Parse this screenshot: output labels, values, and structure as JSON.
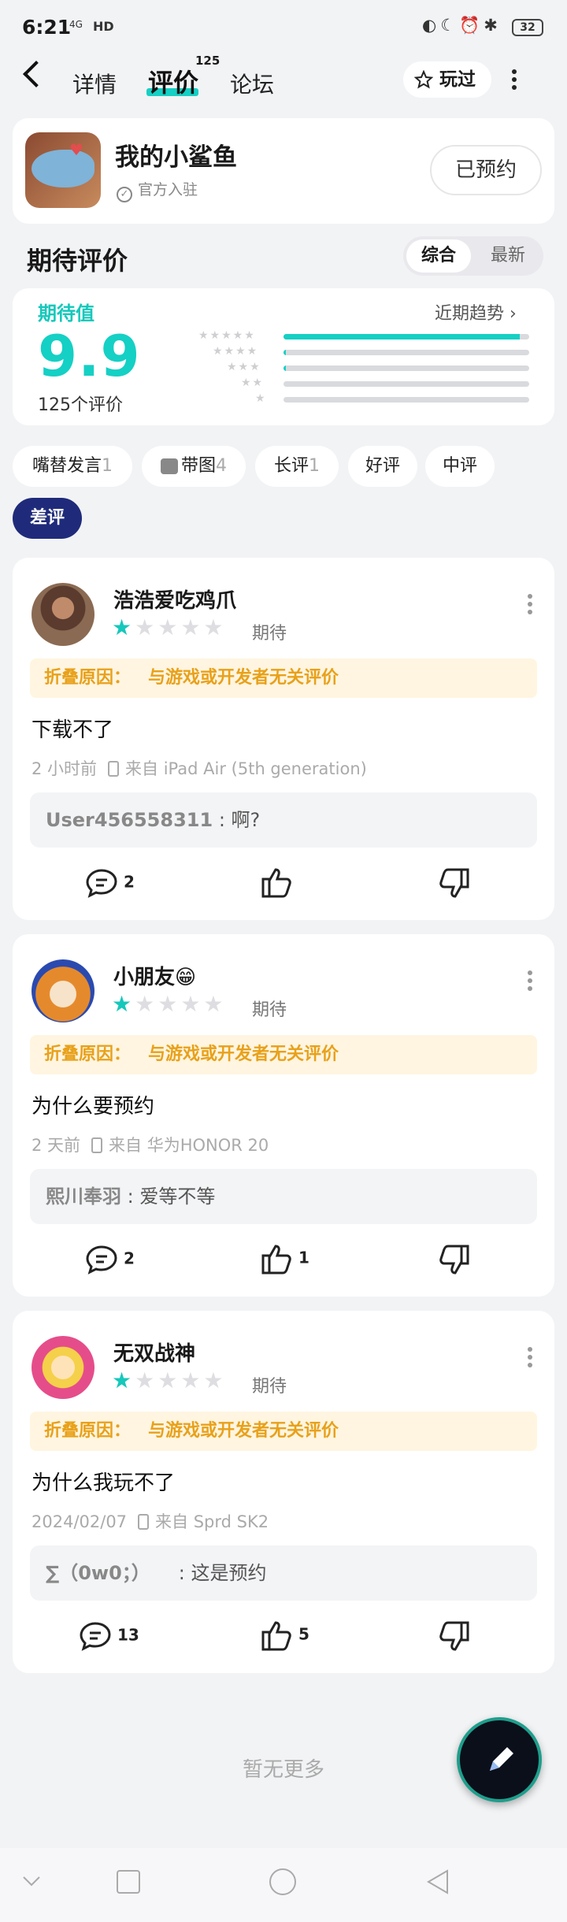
{
  "status": {
    "time": "6:21",
    "signal": "4G",
    "hd": "HD",
    "battery": "32"
  },
  "nav": {
    "tabs": [
      {
        "label": "详情"
      },
      {
        "label": "评价",
        "badge": "125"
      },
      {
        "label": "论坛"
      }
    ],
    "played_label": "玩过"
  },
  "game": {
    "name": "我的小鲨鱼",
    "official": "官方入驻",
    "reserve_label": "已预约"
  },
  "ratings": {
    "section_title": "期待评价",
    "sort_tabs": [
      "综合",
      "最新"
    ],
    "label": "期待值",
    "score": "9.9",
    "count": "125个评价",
    "trend_label": "近期趋势",
    "distribution": [
      0.96,
      0.01,
      0.01,
      0,
      0
    ]
  },
  "filters": [
    {
      "label": "嘴替发言",
      "count": "1"
    },
    {
      "label": "带图",
      "count": "4"
    },
    {
      "label": "长评",
      "count": "1"
    },
    {
      "label": "好评",
      "count": ""
    },
    {
      "label": "中评",
      "count": ""
    },
    {
      "label": "差评",
      "count": ""
    }
  ],
  "reviews": [
    {
      "user": "浩浩爱吃鸡爪",
      "stars": 1,
      "expect": "期待",
      "fold_label": "折叠原因：",
      "fold_reason": "与游戏或开发者无关评价",
      "content": "下载不了",
      "time": "2 小时前",
      "device": "来自 iPad Air (5th generation)",
      "reply_user": "User456558311",
      "reply_text": " : 啊?",
      "comments": "2",
      "likes": ""
    },
    {
      "user": "小朋友😁",
      "stars": 1,
      "expect": "期待",
      "fold_label": "折叠原因：",
      "fold_reason": "与游戏或开发者无关评价",
      "content": "为什么要预约",
      "time": "2 天前",
      "device": "来自 华为HONOR 20",
      "reply_user": "熙川奉羽",
      "reply_text": " : 爱等不等",
      "comments": "2",
      "likes": "1"
    },
    {
      "user": "无双战神",
      "stars": 1,
      "expect": "期待",
      "fold_label": "折叠原因：",
      "fold_reason": "与游戏或开发者无关评价",
      "content": "为什么我玩不了",
      "time": "2024/02/07",
      "device": "来自 Sprd SK2",
      "reply_user": "∑（0w0；）",
      "reply_text": "　　: 这是预约",
      "comments": "13",
      "likes": "5"
    }
  ],
  "footer": {
    "no_more": "暂无更多"
  },
  "colors": {
    "accent": "#15d0c4",
    "fold_bg": "#fff5e0",
    "fold_text": "#e8a11a",
    "chip_active": "#1f2b7a"
  }
}
